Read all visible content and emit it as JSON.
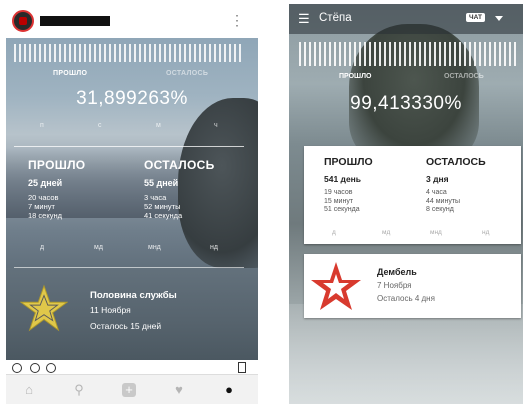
{
  "left_phone": {
    "progress_label": "ПРОШЛО",
    "remaining_label": "ОСТАЛОСЬ",
    "percent": "31,899263%",
    "modes": [
      "п",
      "с",
      "м",
      "ч"
    ],
    "passed": {
      "heading": "ПРОШЛО",
      "days": "25 дней",
      "hours": "20 часов",
      "minutes": "7 минут",
      "seconds": "18 секунд"
    },
    "remaining": {
      "heading": "ОСТАЛОСЬ",
      "days": "55 дней",
      "hours": "3 часа",
      "minutes": "52 минуты",
      "seconds": "41 секунда"
    },
    "units": [
      "д",
      "мд",
      "мнд",
      "нд"
    ],
    "event": {
      "title": "Половина службы",
      "date": "11 Ноября",
      "remaining": "Осталось 15 дней"
    },
    "star_color": "#e0c84a",
    "nav": [
      "home-icon",
      "search-icon",
      "add-icon",
      "heart-icon",
      "profile-icon"
    ]
  },
  "right_phone": {
    "title": "Стёпа",
    "chat_badge": "ЧАТ",
    "progress_label": "ПРОШЛО",
    "remaining_label": "ОСТАЛОСЬ",
    "percent": "99,413330%",
    "passed": {
      "heading": "ПРОШЛО",
      "days": "541 день",
      "hours": "19 часов",
      "minutes": "15 минут",
      "seconds": "51 секунда"
    },
    "remaining": {
      "heading": "ОСТАЛОСЬ",
      "days": "3 дня",
      "hours": "4 часа",
      "minutes": "44 минуты",
      "seconds": "8 секунд"
    },
    "units": [
      "д",
      "мд",
      "мнд",
      "нд"
    ],
    "event": {
      "title": "Дембель",
      "date": "7 Ноября",
      "remaining": "Осталось 4 дня"
    },
    "star_color": "#d83a2e"
  }
}
